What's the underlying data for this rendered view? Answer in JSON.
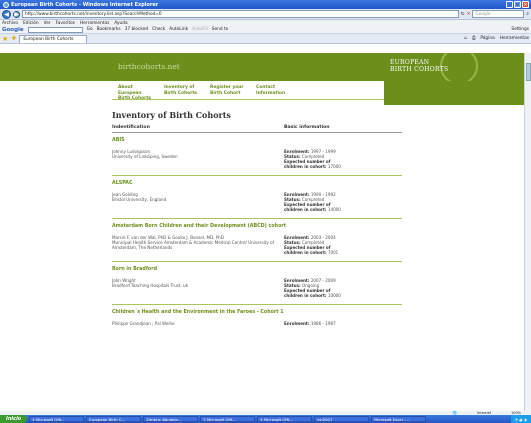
{
  "window": {
    "title": "European Birth Cohorts - Windows Internet Explorer"
  },
  "addressbar": {
    "url": "http://www.birthcohorts.net/inventory.list.asp?SearchMethod=0",
    "search_placeholder": "Google"
  },
  "menu": [
    "Archivo",
    "Edición",
    "Ver",
    "Favoritos",
    "Herramientas",
    "Ayuda"
  ],
  "google_toolbar": {
    "logo": "Google",
    "go": "Go",
    "bookmarks": "Bookmarks",
    "blocked": "37 blocked",
    "check": "Check",
    "autolink": "AutoLink",
    "autofill": "AutoFill",
    "sendto": "Send to",
    "settings": "Settings"
  },
  "tab": {
    "label": "European Birth Cohorts"
  },
  "right_tools": {
    "page": "Página",
    "tools": "Herramientas"
  },
  "site": {
    "name": "birthcohorts.net",
    "logo_line1": "EUROPEAN",
    "logo_line2": "BIRTH COHORTS"
  },
  "nav": [
    {
      "label": "About European Birth Cohorts"
    },
    {
      "label": "Inventory of Birth Cohorts"
    },
    {
      "label": "Register your Birth Cohort"
    },
    {
      "label": "Contact Information"
    }
  ],
  "page": {
    "title": "Inventory of Birth Cohorts",
    "col_left": "Indentification",
    "col_right": "Basic information"
  },
  "labels": {
    "enrolment": "Enrolment:",
    "status": "Status:",
    "expected1": "Expected number of",
    "expected2": "children in cohort:"
  },
  "entries": [
    {
      "name": "ABIS",
      "person": "Johnny Ludvigsson",
      "org": "University of Linköping, Sweden",
      "enrolment": "1997 - 1999",
      "status": "Completed",
      "expected": "17000"
    },
    {
      "name": "ALSPAC",
      "person": "Jean Golding",
      "org": "Bristol University, England",
      "enrolment": "1990 - 1992",
      "status": "Completed",
      "expected": "14000"
    },
    {
      "name": "Amsterdam Born Children and their Development (ABCD) cohort",
      "person": "Marcel F. van der Wal, PhD & Gouke J. Bonsel, MD, PhD",
      "org": "Municipal Health Service Amsterdam & Academic Medical Centre/ University of Amsterdam, The Netherlands",
      "enrolment": "2003 - 2004",
      "status": "Completed",
      "expected": "7001"
    },
    {
      "name": "Born in Bradford",
      "person": "John Wright",
      "org": "Bradford Teaching Hospitals Trust, uk",
      "enrolment": "2007 - 2009",
      "status": "Ongoing",
      "expected": "10000"
    },
    {
      "name": "Children´s Health and the Environment in the Faroes - Cohort 1",
      "person": "Philippe Grandjean ; Pal Weihe",
      "org": "",
      "enrolment": "1986 - 1987",
      "status": "",
      "expected": ""
    }
  ],
  "statusbar": {
    "zone": "Internet",
    "zoom": "100%"
  },
  "taskbar": {
    "start": "Inicio",
    "items": [
      "4 Microsoft Offi...",
      "European Birth C...",
      "Zimbra: Bandeja...",
      "3 Microsoft Offi...",
      "4 Microsoft Offi...",
      "ecl2007",
      "Microsoft Excel -..."
    ]
  }
}
